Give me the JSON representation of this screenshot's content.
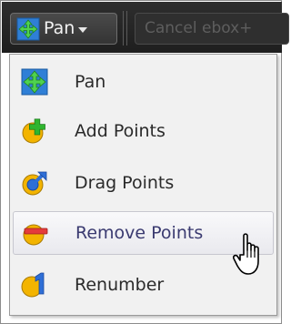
{
  "toolbar": {
    "tool_button_label": "Pan",
    "tool_button_icon": "pan-icon",
    "cancel_button_label": "Cancel ebox+"
  },
  "menu": {
    "items": [
      {
        "label": "Pan",
        "icon": "pan-icon",
        "active": false
      },
      {
        "label": "Add Points",
        "icon": "add-points-icon",
        "active": false
      },
      {
        "label": "Drag Points",
        "icon": "drag-points-icon",
        "active": false
      },
      {
        "label": "Remove Points",
        "icon": "remove-points-icon",
        "active": true
      },
      {
        "label": "Renumber",
        "icon": "renumber-icon",
        "active": false
      }
    ]
  },
  "colors": {
    "toolbar_bg": "#262626",
    "menu_bg": "#f1f1f1",
    "pan_icon_blue": "#2f7fd6",
    "pan_icon_green": "#3cc43c",
    "point_yellow": "#f3b400",
    "plus_green": "#2fb52f",
    "arrow_blue": "#2f6fd6",
    "minus_red": "#e43c3c"
  }
}
